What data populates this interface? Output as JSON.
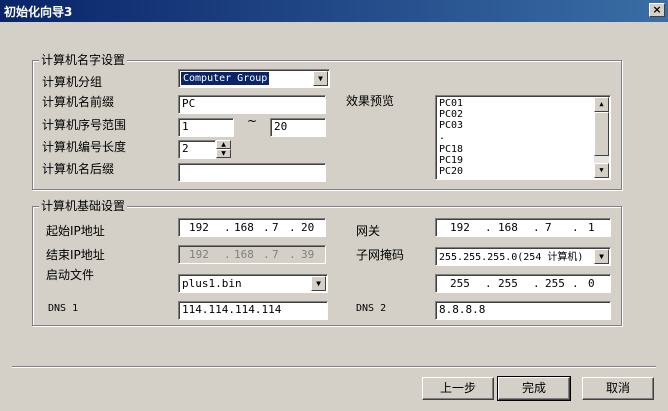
{
  "window": {
    "title": "初始化向导3",
    "close_glyph": "×"
  },
  "name_group": {
    "title": "计算机名字设置",
    "group_label": "计算机分组",
    "group_value": "Computer Group",
    "prefix_label": "计算机名前缀",
    "prefix_value": "PC",
    "range_label": "计算机序号范围",
    "range_from": "1",
    "range_sep": "~",
    "range_to": "20",
    "length_label": "计算机编号长度",
    "length_value": "2",
    "suffix_label": "计算机名后缀",
    "suffix_value": "",
    "preview_label": "效果预览",
    "preview_items": [
      "PC01",
      "PC02",
      "PC03",
      ".",
      "PC18",
      "PC19",
      "PC20"
    ]
  },
  "base_group": {
    "title": "计算机基础设置",
    "start_ip_label": "起始IP地址",
    "start_ip": [
      "192",
      "168",
      "7",
      "20"
    ],
    "end_ip_label": "结束IP地址",
    "end_ip": [
      "192",
      "168",
      "7",
      "39"
    ],
    "boot_label": "启动文件",
    "boot_value": "plus1.bin",
    "dns1_label": "DNS 1",
    "dns1_value": "114.114.114.114",
    "gateway_label": "网关",
    "gateway": [
      "192",
      "168",
      "7",
      "1"
    ],
    "mask_label": "子网掩码",
    "mask_value": "255.255.255.0(254 计算机)",
    "mask_ip": [
      "255",
      "255",
      "255",
      "0"
    ],
    "dns2_label": "DNS 2",
    "dns2_value": "8.8.8.8"
  },
  "buttons": {
    "prev": "上一步",
    "finish": "完成",
    "cancel": "取消"
  },
  "colors": {
    "face": "#d4d0c8",
    "title_start": "#0a246a",
    "title_end": "#3a6ea5",
    "selection": "#0a246a"
  }
}
